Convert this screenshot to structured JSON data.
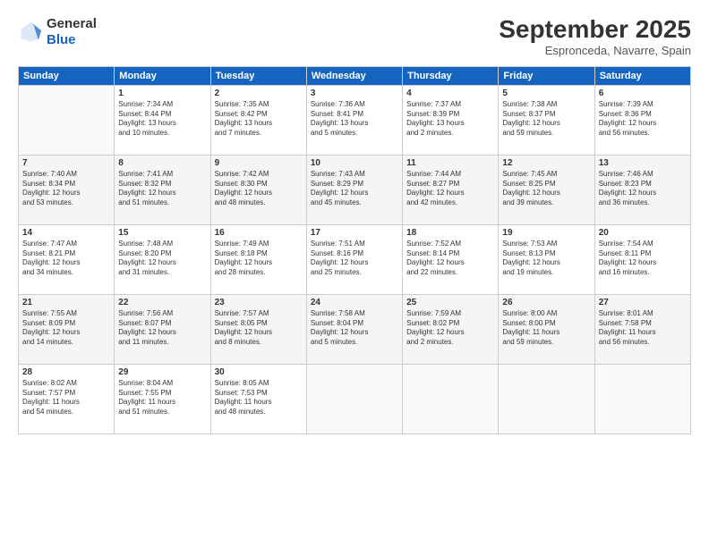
{
  "logo": {
    "general": "General",
    "blue": "Blue"
  },
  "title": "September 2025",
  "subtitle": "Espronceda, Navarre, Spain",
  "headers": [
    "Sunday",
    "Monday",
    "Tuesday",
    "Wednesday",
    "Thursday",
    "Friday",
    "Saturday"
  ],
  "weeks": [
    [
      {
        "day": "",
        "info": ""
      },
      {
        "day": "1",
        "info": "Sunrise: 7:34 AM\nSunset: 8:44 PM\nDaylight: 13 hours\nand 10 minutes."
      },
      {
        "day": "2",
        "info": "Sunrise: 7:35 AM\nSunset: 8:42 PM\nDaylight: 13 hours\nand 7 minutes."
      },
      {
        "day": "3",
        "info": "Sunrise: 7:36 AM\nSunset: 8:41 PM\nDaylight: 13 hours\nand 5 minutes."
      },
      {
        "day": "4",
        "info": "Sunrise: 7:37 AM\nSunset: 8:39 PM\nDaylight: 13 hours\nand 2 minutes."
      },
      {
        "day": "5",
        "info": "Sunrise: 7:38 AM\nSunset: 8:37 PM\nDaylight: 12 hours\nand 59 minutes."
      },
      {
        "day": "6",
        "info": "Sunrise: 7:39 AM\nSunset: 8:36 PM\nDaylight: 12 hours\nand 56 minutes."
      }
    ],
    [
      {
        "day": "7",
        "info": "Sunrise: 7:40 AM\nSunset: 8:34 PM\nDaylight: 12 hours\nand 53 minutes."
      },
      {
        "day": "8",
        "info": "Sunrise: 7:41 AM\nSunset: 8:32 PM\nDaylight: 12 hours\nand 51 minutes."
      },
      {
        "day": "9",
        "info": "Sunrise: 7:42 AM\nSunset: 8:30 PM\nDaylight: 12 hours\nand 48 minutes."
      },
      {
        "day": "10",
        "info": "Sunrise: 7:43 AM\nSunset: 8:29 PM\nDaylight: 12 hours\nand 45 minutes."
      },
      {
        "day": "11",
        "info": "Sunrise: 7:44 AM\nSunset: 8:27 PM\nDaylight: 12 hours\nand 42 minutes."
      },
      {
        "day": "12",
        "info": "Sunrise: 7:45 AM\nSunset: 8:25 PM\nDaylight: 12 hours\nand 39 minutes."
      },
      {
        "day": "13",
        "info": "Sunrise: 7:46 AM\nSunset: 8:23 PM\nDaylight: 12 hours\nand 36 minutes."
      }
    ],
    [
      {
        "day": "14",
        "info": "Sunrise: 7:47 AM\nSunset: 8:21 PM\nDaylight: 12 hours\nand 34 minutes."
      },
      {
        "day": "15",
        "info": "Sunrise: 7:48 AM\nSunset: 8:20 PM\nDaylight: 12 hours\nand 31 minutes."
      },
      {
        "day": "16",
        "info": "Sunrise: 7:49 AM\nSunset: 8:18 PM\nDaylight: 12 hours\nand 28 minutes."
      },
      {
        "day": "17",
        "info": "Sunrise: 7:51 AM\nSunset: 8:16 PM\nDaylight: 12 hours\nand 25 minutes."
      },
      {
        "day": "18",
        "info": "Sunrise: 7:52 AM\nSunset: 8:14 PM\nDaylight: 12 hours\nand 22 minutes."
      },
      {
        "day": "19",
        "info": "Sunrise: 7:53 AM\nSunset: 8:13 PM\nDaylight: 12 hours\nand 19 minutes."
      },
      {
        "day": "20",
        "info": "Sunrise: 7:54 AM\nSunset: 8:11 PM\nDaylight: 12 hours\nand 16 minutes."
      }
    ],
    [
      {
        "day": "21",
        "info": "Sunrise: 7:55 AM\nSunset: 8:09 PM\nDaylight: 12 hours\nand 14 minutes."
      },
      {
        "day": "22",
        "info": "Sunrise: 7:56 AM\nSunset: 8:07 PM\nDaylight: 12 hours\nand 11 minutes."
      },
      {
        "day": "23",
        "info": "Sunrise: 7:57 AM\nSunset: 8:05 PM\nDaylight: 12 hours\nand 8 minutes."
      },
      {
        "day": "24",
        "info": "Sunrise: 7:58 AM\nSunset: 8:04 PM\nDaylight: 12 hours\nand 5 minutes."
      },
      {
        "day": "25",
        "info": "Sunrise: 7:59 AM\nSunset: 8:02 PM\nDaylight: 12 hours\nand 2 minutes."
      },
      {
        "day": "26",
        "info": "Sunrise: 8:00 AM\nSunset: 8:00 PM\nDaylight: 11 hours\nand 59 minutes."
      },
      {
        "day": "27",
        "info": "Sunrise: 8:01 AM\nSunset: 7:58 PM\nDaylight: 11 hours\nand 56 minutes."
      }
    ],
    [
      {
        "day": "28",
        "info": "Sunrise: 8:02 AM\nSunset: 7:57 PM\nDaylight: 11 hours\nand 54 minutes."
      },
      {
        "day": "29",
        "info": "Sunrise: 8:04 AM\nSunset: 7:55 PM\nDaylight: 11 hours\nand 51 minutes."
      },
      {
        "day": "30",
        "info": "Sunrise: 8:05 AM\nSunset: 7:53 PM\nDaylight: 11 hours\nand 48 minutes."
      },
      {
        "day": "",
        "info": ""
      },
      {
        "day": "",
        "info": ""
      },
      {
        "day": "",
        "info": ""
      },
      {
        "day": "",
        "info": ""
      }
    ]
  ]
}
